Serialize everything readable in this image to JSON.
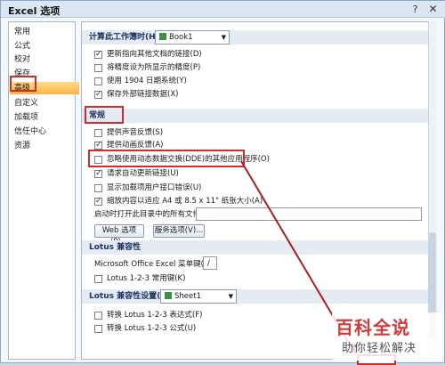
{
  "title": "Excel 选项",
  "controls": {
    "help": "?",
    "close": "✕"
  },
  "sidebar": {
    "items": [
      {
        "label": "常用"
      },
      {
        "label": "公式"
      },
      {
        "label": "校对"
      },
      {
        "label": "保存"
      },
      {
        "label": "高级",
        "selected": true
      },
      {
        "label": "自定义"
      },
      {
        "label": "加载项"
      },
      {
        "label": "信任中心"
      },
      {
        "label": "资源"
      }
    ]
  },
  "calc_section": {
    "header": "计算此工作簿时(H):",
    "workbook": "Book1",
    "options": [
      {
        "label": "更新指向其他文档的链接(D)",
        "checked": true
      },
      {
        "label": "将精度设为所显示的精度(P)",
        "checked": false
      },
      {
        "label": "使用 1904 日期系统(Y)",
        "checked": false
      },
      {
        "label": "保存外部链接数据(X)",
        "checked": true
      }
    ]
  },
  "general_section": {
    "header": "常规",
    "options": [
      {
        "label": "提供声音反馈(S)",
        "checked": false
      },
      {
        "label": "提供动画反馈(A)",
        "checked": true
      },
      {
        "label": "忽略使用动态数据交换(DDE)的其他应用程序(O)",
        "checked": false
      },
      {
        "label": "请求自动更新链接(U)",
        "checked": true
      },
      {
        "label": "显示加载项用户接口错误(U)",
        "checked": false
      },
      {
        "label": "缩放内容以适应 A4 或 8.5 x 11\" 纸张大小(A)",
        "checked": true
      }
    ],
    "startup_label": "启动时打开此目录中的所有文件(L):",
    "startup_value": "",
    "web_button": "Web 选项(P)...",
    "service_button": "服务选项(V)..."
  },
  "lotus_section": {
    "header": "Lotus 兼容性",
    "menu_key_label": "Microsoft Office Excel 菜单键(M):",
    "menu_key_value": "/",
    "option": {
      "label": "Lotus 1-2-3 常用键(K)",
      "checked": false
    }
  },
  "lotus_settings_section": {
    "header": "Lotus 兼容性设置(L):",
    "sheet": "Sheet1",
    "options": [
      {
        "label": "转换 Lotus 1-2-3 表达式(F)",
        "checked": false
      },
      {
        "label": "转换 Lotus 1-2-3 公式(U)",
        "checked": false
      }
    ]
  },
  "watermark": {
    "line1": "百科全说",
    "line2": "助你轻松解决"
  },
  "colors": {
    "highlight": "#d42b2b",
    "selected_nav": "#ffb347"
  }
}
